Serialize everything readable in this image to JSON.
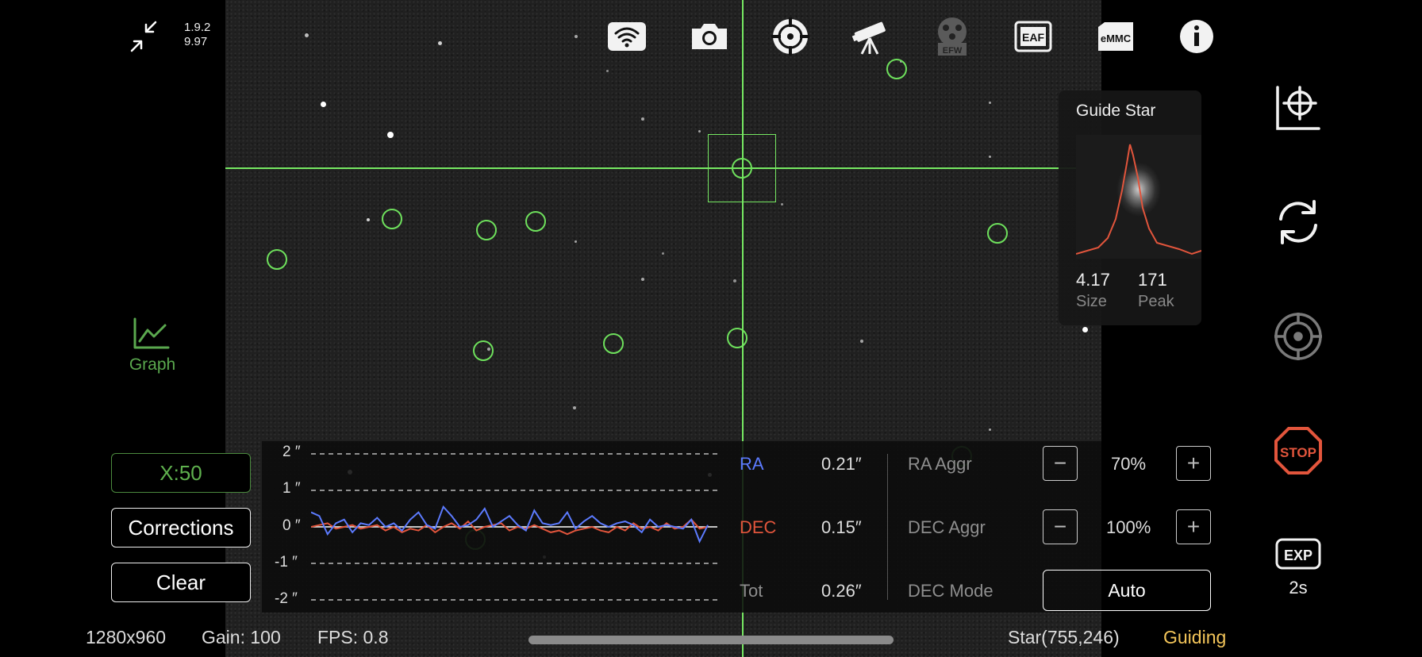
{
  "app": {
    "version": "1.9.2",
    "build": "9.97"
  },
  "toolbar": {
    "icons": [
      "wifi-icon",
      "camera-icon",
      "focus-target-icon",
      "telescope-icon",
      "efw-icon",
      "eaf-icon",
      "emmc-icon",
      "info-icon"
    ],
    "efw_label": "EFW",
    "eaf_label": "EAF",
    "emmc_label": "eMMC"
  },
  "left_panel": {
    "graph_label": "Graph",
    "scale_label": "X:50",
    "corrections_label": "Corrections",
    "clear_label": "Clear"
  },
  "graph": {
    "scale_labels": [
      "2 ″",
      "1 ″",
      "0 ″",
      "-1 ″",
      "-2 ″"
    ],
    "colors": {
      "ra": "#5c7bff",
      "dec": "#e2553c",
      "zero": "#ffffff"
    }
  },
  "chart_data": {
    "type": "line",
    "ylim": [
      -2,
      2
    ],
    "series": [
      {
        "name": "RA",
        "values": [
          0.4,
          0.3,
          -0.2,
          0.1,
          0.2,
          -0.15,
          0.1,
          0.05,
          0.25,
          0.0,
          0.1,
          -0.1,
          0.2,
          0.4,
          0.05,
          -0.05,
          0.55,
          0.3,
          0.0,
          0.05,
          0.2,
          0.5,
          0.0,
          0.15,
          0.3,
          0.05,
          -0.1,
          0.45,
          0.1,
          0.05,
          0.1,
          0.4,
          -0.05,
          0.15,
          0.3,
          0.1,
          0.0,
          0.1,
          0.15,
          0.05,
          -0.15,
          0.2,
          0.0,
          0.05,
          0.0,
          -0.05,
          0.2,
          -0.4,
          0.05
        ]
      },
      {
        "name": "DEC",
        "values": [
          0.0,
          0.05,
          0.1,
          -0.05,
          0.0,
          0.05,
          -0.05,
          0.0,
          0.05,
          -0.1,
          0.0,
          -0.15,
          -0.05,
          -0.1,
          0.05,
          -0.15,
          0.0,
          0.1,
          -0.05,
          0.15,
          -0.1,
          0.0,
          0.05,
          0.1,
          -0.1,
          0.0,
          -0.05,
          0.05,
          -0.05,
          -0.15,
          -0.1,
          -0.2,
          -0.1,
          -0.05,
          0.0,
          -0.1,
          -0.15,
          0.0,
          -0.1,
          0.1,
          -0.05,
          0.0,
          -0.1,
          0.1,
          -0.05,
          0.0,
          0.2,
          -0.05,
          0.0
        ]
      }
    ]
  },
  "stats": {
    "ra_label": "RA",
    "ra_value": "0.21″",
    "dec_label": "DEC",
    "dec_value": "0.15″",
    "tot_label": "Tot",
    "tot_value": "0.26″"
  },
  "settings": {
    "ra_aggr_label": "RA Aggr",
    "ra_aggr_value": "70%",
    "dec_aggr_label": "DEC Aggr",
    "dec_aggr_value": "100%",
    "dec_mode_label": "DEC Mode",
    "dec_mode_value": "Auto",
    "minus": "−",
    "plus": "+"
  },
  "guide_star": {
    "title": "Guide Star",
    "size_value": "4.17",
    "size_label": "Size",
    "peak_value": "171",
    "peak_label": "Peak"
  },
  "right_panel": {
    "stop_label": "STOP",
    "exp_label": "EXP",
    "exposure": "2s"
  },
  "status_bar": {
    "resolution": "1280x960",
    "gain": "Gain: 100",
    "fps": "FPS: 0.8",
    "star_position": "Star(755,246)",
    "state": "Guiding",
    "state_color": "#f3c55a"
  }
}
